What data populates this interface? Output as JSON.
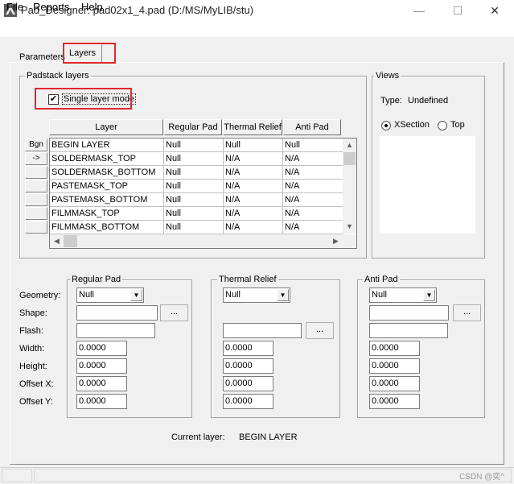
{
  "window": {
    "title": "Pad_Designer: pad02x1_4.pad (D:/MS/MyLIB/stu)",
    "minimize": "—",
    "maximize": "☐",
    "close": "✕"
  },
  "menu": [
    "File",
    "Reports",
    "Help"
  ],
  "tabs": {
    "parameters": "Parameters",
    "layers": "Layers"
  },
  "padstack": {
    "group_label": "Padstack layers",
    "single_layer_mode_label": "Single layer mode",
    "single_layer_mode_checked": "✔",
    "columns": [
      "Layer",
      "Regular Pad",
      "Thermal Relief",
      "Anti Pad"
    ],
    "row_buttons": [
      "Bgn",
      "->",
      "",
      "",
      "",
      "",
      ""
    ],
    "rows": [
      [
        "BEGIN LAYER",
        "Null",
        "Null",
        "Null"
      ],
      [
        "SOLDERMASK_TOP",
        "Null",
        "N/A",
        "N/A"
      ],
      [
        "SOLDERMASK_BOTTOM",
        "Null",
        "N/A",
        "N/A"
      ],
      [
        "PASTEMASK_TOP",
        "Null",
        "N/A",
        "N/A"
      ],
      [
        "PASTEMASK_BOTTOM",
        "Null",
        "N/A",
        "N/A"
      ],
      [
        "FILMMASK_TOP",
        "Null",
        "N/A",
        "N/A"
      ],
      [
        "FILMMASK_BOTTOM",
        "Null",
        "N/A",
        "N/A"
      ]
    ]
  },
  "views": {
    "group_label": "Views",
    "type_label": "Type:",
    "type_value": "Undefined",
    "xsection_label": "XSection",
    "top_label": "Top",
    "selected": "XSection"
  },
  "pads": {
    "row_labels": [
      "Geometry:",
      "Shape:",
      "Flash:",
      "Width:",
      "Height:",
      "Offset X:",
      "Offset Y:"
    ],
    "regular": {
      "label": "Regular Pad",
      "geometry": "Null",
      "shape": "",
      "flash": "",
      "width": "0.0000",
      "height": "0.0000",
      "offset_x": "0.0000",
      "offset_y": "0.0000"
    },
    "thermal": {
      "label": "Thermal Relief",
      "geometry": "Null",
      "flash": "",
      "width": "0.0000",
      "height": "0.0000",
      "offset_x": "0.0000",
      "offset_y": "0.0000"
    },
    "anti": {
      "label": "Anti Pad",
      "geometry": "Null",
      "shape": "",
      "flash": "",
      "width": "0.0000",
      "height": "0.0000",
      "offset_x": "0.0000",
      "offset_y": "0.0000"
    },
    "browse_label": "..."
  },
  "current_layer": {
    "label": "Current layer:",
    "value": "BEGIN LAYER"
  },
  "watermark": "CSDN @奕^",
  "colors": {
    "highlight": "#e0282e",
    "background": "#f0f0f0"
  }
}
